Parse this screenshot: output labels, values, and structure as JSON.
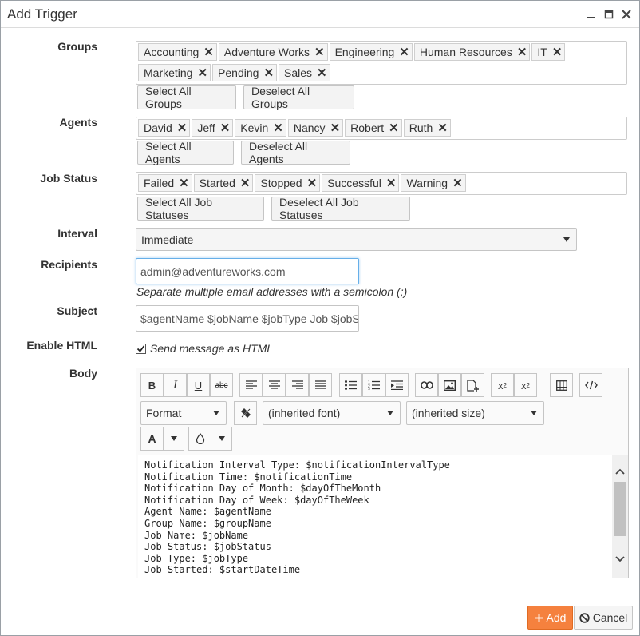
{
  "window": {
    "title": "Add Trigger"
  },
  "labels": {
    "groups": "Groups",
    "agents": "Agents",
    "job_status": "Job Status",
    "interval": "Interval",
    "recipients": "Recipients",
    "subject": "Subject",
    "enable_html": "Enable HTML",
    "body": "Body"
  },
  "groups": {
    "tags": [
      "Accounting",
      "Adventure Works",
      "Engineering",
      "Human Resources",
      "IT",
      "Marketing",
      "Pending",
      "Sales"
    ],
    "select_all": "Select All Groups",
    "deselect_all": "Deselect All Groups"
  },
  "agents": {
    "tags": [
      "David",
      "Jeff",
      "Kevin",
      "Nancy",
      "Robert",
      "Ruth"
    ],
    "select_all": "Select All Agents",
    "deselect_all": "Deselect All Agents"
  },
  "job_status": {
    "tags": [
      "Failed",
      "Started",
      "Stopped",
      "Successful",
      "Warning"
    ],
    "select_all": "Select All Job Statuses",
    "deselect_all": "Deselect All Job Statuses"
  },
  "interval": {
    "value": "Immediate"
  },
  "recipients": {
    "value": "admin@adventureworks.com",
    "hint": "Separate multiple email addresses with a semicolon (;)"
  },
  "subject": {
    "value": "$agentName $jobName $jobType Job $jobS"
  },
  "enable_html": {
    "checked": true,
    "label": "Send message as HTML"
  },
  "editor": {
    "format": "Format",
    "font": "(inherited font)",
    "size": "(inherited size)",
    "font_color_label": "A",
    "body_lines": [
      "Notification Interval Type: $notificationIntervalType",
      "Notification Time: $notificationTime",
      "Notification Day of Month: $dayOfTheMonth",
      "Notification Day of Week: $dayOfTheWeek",
      "Agent Name: $agentName",
      "Group Name: $groupName",
      "Job Name: $jobName",
      "Job Status: $jobStatus",
      "Job Type: $jobType",
      "Job Started: $startDateTime"
    ]
  },
  "footer": {
    "add": "Add",
    "cancel": "Cancel"
  },
  "colors": {
    "accent": "#f5813e"
  }
}
